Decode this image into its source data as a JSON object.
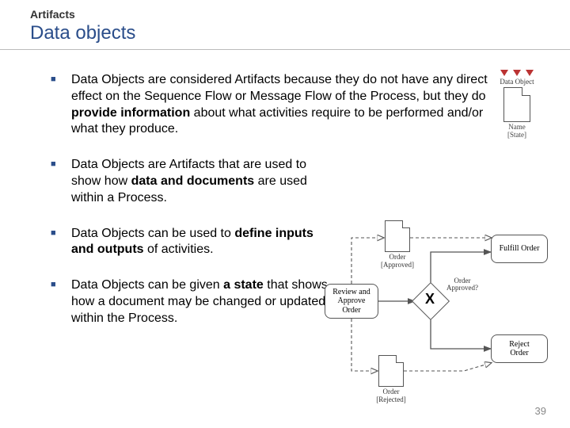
{
  "header": {
    "section": "Artifacts",
    "title": "Data objects"
  },
  "bullets": {
    "b1_pre": "Data Objects are considered Artifacts because they do not have any direct effect on the Sequence Flow or Message Flow of the Process, but they do ",
    "b1_bold": "provide information",
    "b1_post": " about what activities require to be performed and/or what they produce.",
    "b2_pre": "Data Objects are Artifacts that are used to show how ",
    "b2_bold": "data and documents",
    "b2_post": " are used within a Process.",
    "b3_pre": "Data Objects can be used to ",
    "b3_bold": "define inputs and outputs",
    "b3_post": " of activities.",
    "b4_pre": "Data Objects can be given ",
    "b4_bold": "a state",
    "b4_post": " that shows how a document may be changed or updated within the Process."
  },
  "icon": {
    "label": "Data Object",
    "name": "Name",
    "state": "[State]"
  },
  "diagram": {
    "task_review": "Review and\nApprove\nOrder",
    "task_fulfill": "Fulfill Order",
    "task_reject": "Reject\nOrder",
    "doc_top": "Order\n[Approved]",
    "doc_bottom": "Order\n[Rejected]",
    "gateway_label": "Order\nApproved?"
  },
  "page_number": "39"
}
